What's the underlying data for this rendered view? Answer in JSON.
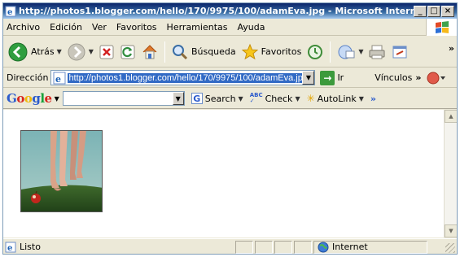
{
  "window": {
    "title": "http://photos1.blogger.com/hello/170/9975/100/adamEva.jpg - Microsoft Internet...",
    "min_glyph": "_",
    "max_glyph": "□",
    "close_glyph": "×"
  },
  "menu": {
    "items": [
      "Archivo",
      "Edición",
      "Ver",
      "Favoritos",
      "Herramientas",
      "Ayuda"
    ]
  },
  "toolbar": {
    "back_label": "Atrás",
    "search_label": "Búsqueda",
    "favorites_label": "Favoritos",
    "more_glyph": "»"
  },
  "address": {
    "label": "Dirección",
    "url": "http://photos1.blogger.com/hello/170/9975/100/adamEva.jpg",
    "go_label": "Ir",
    "links_label": "Vínculos"
  },
  "google": {
    "search_value": "",
    "search_label": "Search",
    "check_label": "Check",
    "autolink_label": "AutoLink",
    "more_glyph": "»"
  },
  "status": {
    "text": "Listo",
    "zone": "Internet"
  },
  "colors": {
    "titlebar": "#0a246a",
    "url_highlight": "#316ac5",
    "chrome": "#ece9d8"
  }
}
